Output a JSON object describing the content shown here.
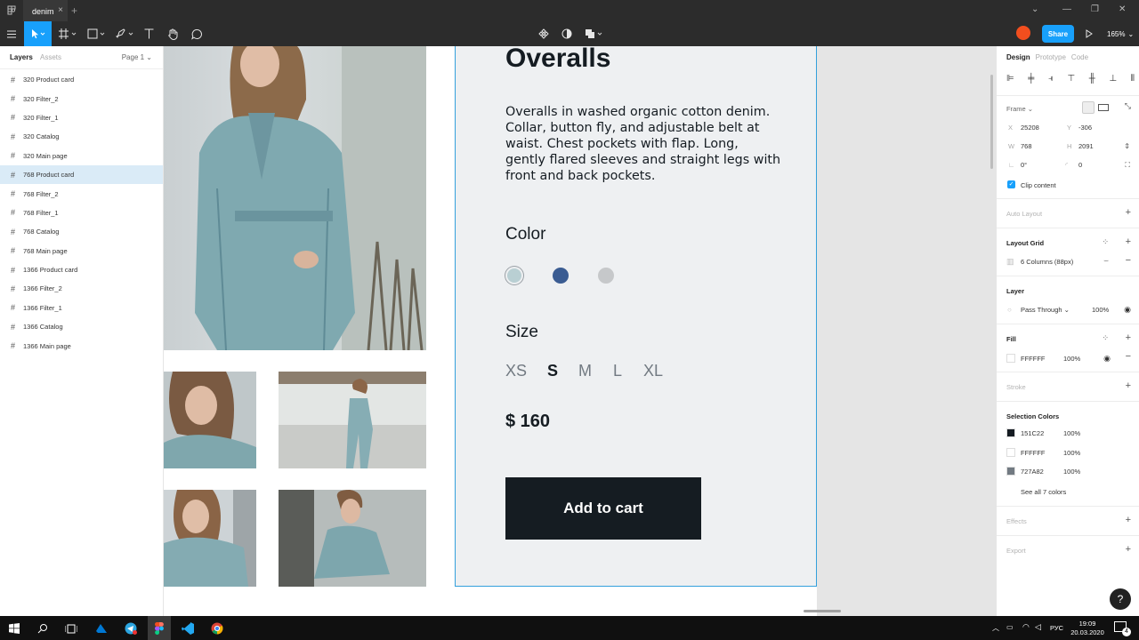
{
  "window": {
    "tab_title": "denim",
    "tab_close": "×",
    "new_tab": "+"
  },
  "toolbar": {
    "share_label": "Share",
    "zoom": "165%",
    "zoom_arrow": "⌄"
  },
  "layers_panel": {
    "tab_layers": "Layers",
    "tab_assets": "Assets",
    "page_selector": "Page 1 ⌄",
    "items": [
      {
        "label": "320 Product card"
      },
      {
        "label": "320 Filter_2"
      },
      {
        "label": "320 Filter_1"
      },
      {
        "label": "320 Catalog"
      },
      {
        "label": "320 Main page"
      },
      {
        "label": "768 Product card"
      },
      {
        "label": "768 Filter_2"
      },
      {
        "label": "768 Filter_1"
      },
      {
        "label": "768 Catalog"
      },
      {
        "label": "768 Main page"
      },
      {
        "label": "1366 Product card"
      },
      {
        "label": "1366 Filter_2"
      },
      {
        "label": "1366 Filter_1"
      },
      {
        "label": "1366 Catalog"
      },
      {
        "label": "1366 Main page"
      }
    ],
    "selected_index": 5
  },
  "product": {
    "title": "Overalls",
    "description": "Overalls in washed organic cotton denim. Collar, button fly, and adjustable belt at waist. Chest pockets with flap. Long, gently flared sleeves and straight legs with front and back pockets.",
    "color_label": "Color",
    "colors": [
      "#b9cfd3",
      "#3a5c92",
      "#c6c8ca"
    ],
    "size_label": "Size",
    "sizes": [
      "XS",
      "S",
      "M",
      "L",
      "XL"
    ],
    "selected_size": "S",
    "price": "$ 160",
    "cart_label": "Add to cart"
  },
  "design_panel": {
    "tabs": [
      "Design",
      "Prototype",
      "Code"
    ],
    "frame_label": "Frame ⌄",
    "x_key": "X",
    "x_val": "25208",
    "y_key": "Y",
    "y_val": "-306",
    "w_key": "W",
    "w_val": "768",
    "h_key": "H",
    "h_val": "2091",
    "rotation": "0°",
    "radius": "0",
    "clip_content": "Clip content",
    "auto_layout": "Auto Layout",
    "layout_grid": "Layout Grid",
    "grid_item": "6 Columns (88px)",
    "layer": "Layer",
    "blend": "Pass Through ⌄",
    "layer_opacity": "100%",
    "fill": "Fill",
    "fill_hex": "FFFFFF",
    "fill_opacity": "100%",
    "stroke": "Stroke",
    "selection_colors": "Selection Colors",
    "sel_colors": [
      {
        "hex": "151C22",
        "opacity": "100%",
        "swatch": "#151c22"
      },
      {
        "hex": "FFFFFF",
        "opacity": "100%",
        "swatch": "#ffffff"
      },
      {
        "hex": "727A82",
        "opacity": "100%",
        "swatch": "#727a82"
      }
    ],
    "see_all": "See all 7 colors",
    "effects": "Effects",
    "export": "Export",
    "plus": "+",
    "minus": "−"
  },
  "help": "?",
  "taskbar": {
    "lang": "РУС",
    "time": "19:09",
    "date": "20.03.2020",
    "notif_count": "4"
  }
}
